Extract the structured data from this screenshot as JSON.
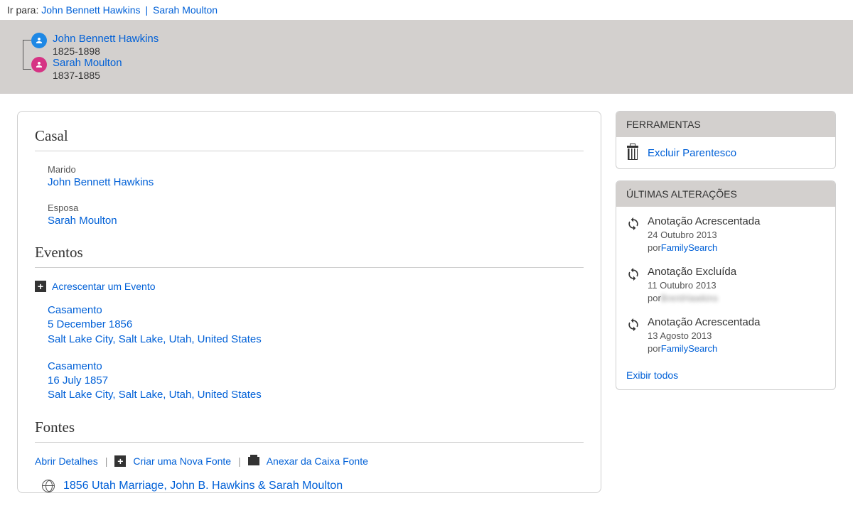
{
  "nav": {
    "goto": "Ir para:",
    "p1": "John Bennett Hawkins",
    "sep": "|",
    "p2": "Sarah Moulton"
  },
  "couple": {
    "husband": {
      "name": "John Bennett Hawkins",
      "dates": "1825-1898"
    },
    "wife": {
      "name": "Sarah Moulton",
      "dates": "1837-1885"
    }
  },
  "main": {
    "couple_title": "Casal",
    "husband_label": "Marido",
    "husband_name": "John Bennett Hawkins",
    "wife_label": "Esposa",
    "wife_name": "Sarah Moulton",
    "events_title": "Eventos",
    "add_event": "Acrescentar um Evento",
    "events": [
      {
        "type": "Casamento",
        "date": "5 December 1856",
        "place": "Salt Lake City, Salt Lake, Utah, United States"
      },
      {
        "type": "Casamento",
        "date": "16 July 1857",
        "place": "Salt Lake City, Salt Lake, Utah, United States"
      }
    ],
    "sources_title": "Fontes",
    "open_details": "Abrir Detalhes",
    "new_source": "Criar uma Nova Fonte",
    "attach_source": "Anexar da Caixa Fonte",
    "source_item": "1856 Utah Marriage, John B. Hawkins & Sarah Moulton"
  },
  "tools": {
    "head": "FERRAMENTAS",
    "delete_rel": "Excluir Parentesco"
  },
  "changes": {
    "head": "ÚLTIMAS ALTERAÇÕES",
    "by": "por",
    "items": [
      {
        "title": "Anotação Acrescentada",
        "date": "24 Outubro 2013",
        "user": "FamilySearch",
        "blur": false
      },
      {
        "title": "Anotação Excluída",
        "date": "11 Outubro 2013",
        "user": "BrentHawkins",
        "blur": true
      },
      {
        "title": "Anotação Acrescentada",
        "date": "13 Agosto 2013",
        "user": "FamilySearch",
        "blur": false
      }
    ],
    "show_all": "Exibir todos"
  }
}
